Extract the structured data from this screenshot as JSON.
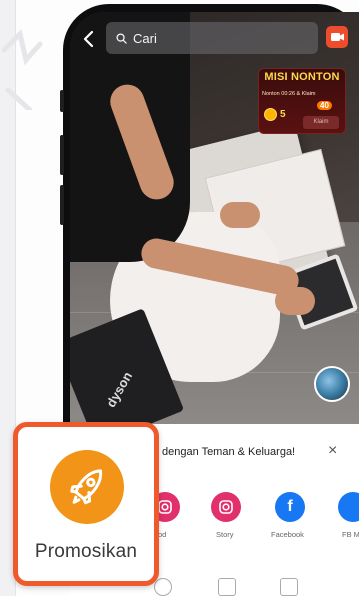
{
  "search": {
    "placeholder": "Cari"
  },
  "mission": {
    "title": "MISI NONTON",
    "subtitle": "Nonton 00:26 & Klaim",
    "coins": "5",
    "badge": "40",
    "claim_label": "Klaim"
  },
  "video": {
    "box_label": "dyson"
  },
  "share_sheet": {
    "title": "dengan Teman & Keluarga!",
    "close_label": "×",
    "items": [
      {
        "label": "od",
        "color": "#e1306c"
      },
      {
        "label": "Story",
        "color": "#e1306c"
      },
      {
        "label": "Facebook",
        "color": "#1877f2"
      },
      {
        "label": "FB Me",
        "color": "#1877f2"
      }
    ]
  },
  "promo": {
    "label": "Promosikan"
  },
  "colors": {
    "accent": "#ee5a2c",
    "promo_circle": "#f29417",
    "shopee": "#ee4d2d"
  }
}
